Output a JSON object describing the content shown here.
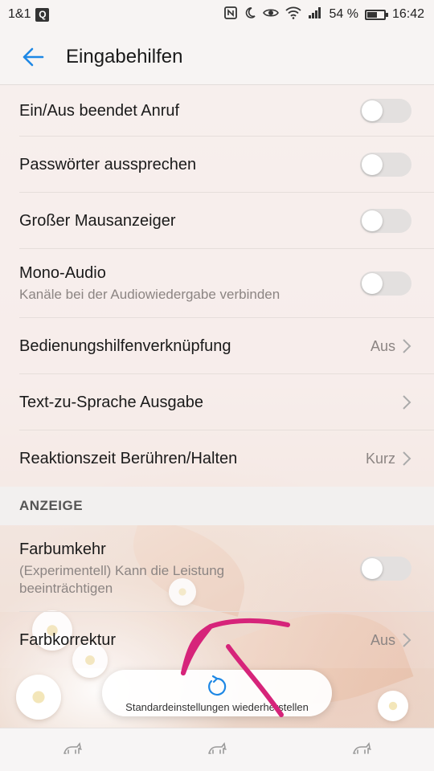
{
  "statusbar": {
    "carrier": "1&1",
    "carrier_badge": "Q",
    "battery_percent": "54 %",
    "time": "16:42",
    "icons": [
      "nfc-icon",
      "moon-icon",
      "eye-icon",
      "wifi-icon",
      "signal-icon",
      "battery-icon"
    ]
  },
  "appbar": {
    "title": "Eingabehilfen",
    "back_icon": "arrow-left-icon",
    "accent": "#1e88e5"
  },
  "items": [
    {
      "label": "Ein/Aus beendet Anruf",
      "type": "toggle",
      "on": false
    },
    {
      "label": "Passwörter aussprechen",
      "type": "toggle",
      "on": false
    },
    {
      "label": "Großer Mausanzeiger",
      "type": "toggle",
      "on": false
    },
    {
      "label": "Mono-Audio",
      "sub": "Kanäle bei der Audiowiedergabe verbinden",
      "type": "toggle",
      "on": false
    },
    {
      "label": "Bedienungshilfenverknüpfung",
      "type": "nav",
      "value": "Aus"
    },
    {
      "label": "Text-zu-Sprache Ausgabe",
      "type": "nav",
      "value": ""
    },
    {
      "label": "Reaktionszeit Berühren/Halten",
      "type": "nav",
      "value": "Kurz"
    }
  ],
  "section_display": {
    "header": "ANZEIGE",
    "items": [
      {
        "label": "Farbumkehr",
        "sub": "(Experimentell) Kann die Leistung beeinträchtigen",
        "type": "toggle",
        "on": false
      },
      {
        "label": "Farbkorrektur",
        "type": "nav",
        "value": "Aus"
      }
    ]
  },
  "restore": {
    "label": "Standardeinstellungen wiederherstellen",
    "icon": "refresh-icon"
  },
  "navbar": {
    "icons": [
      "cat-icon",
      "cat-icon",
      "cat-icon"
    ]
  },
  "annotation_color": "#d6247a"
}
